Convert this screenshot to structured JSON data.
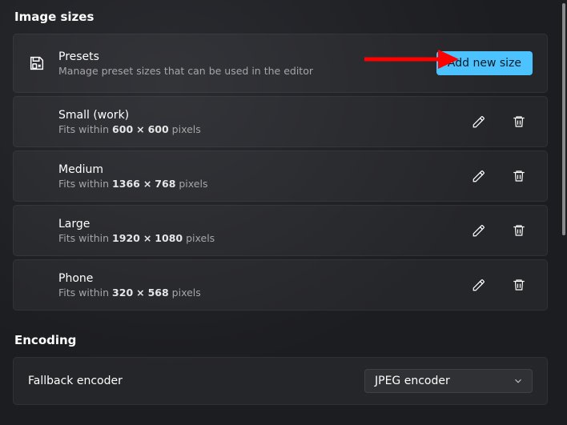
{
  "sections": {
    "image_sizes": {
      "title": "Image sizes"
    },
    "encoding": {
      "title": "Encoding"
    }
  },
  "presets_header": {
    "title": "Presets",
    "subtitle": "Manage preset sizes that can be used in the editor",
    "add_button": "Add new size"
  },
  "fits_label_prefix": "Fits within",
  "fits_label_suffix": "pixels",
  "size_separator": "×",
  "presets": [
    {
      "name": "Small (work)",
      "w": "600",
      "h": "600"
    },
    {
      "name": "Medium",
      "w": "1366",
      "h": "768"
    },
    {
      "name": "Large",
      "w": "1920",
      "h": "1080"
    },
    {
      "name": "Phone",
      "w": "320",
      "h": "568"
    }
  ],
  "encoding": {
    "fallback_label": "Fallback encoder",
    "fallback_value": "JPEG encoder"
  }
}
